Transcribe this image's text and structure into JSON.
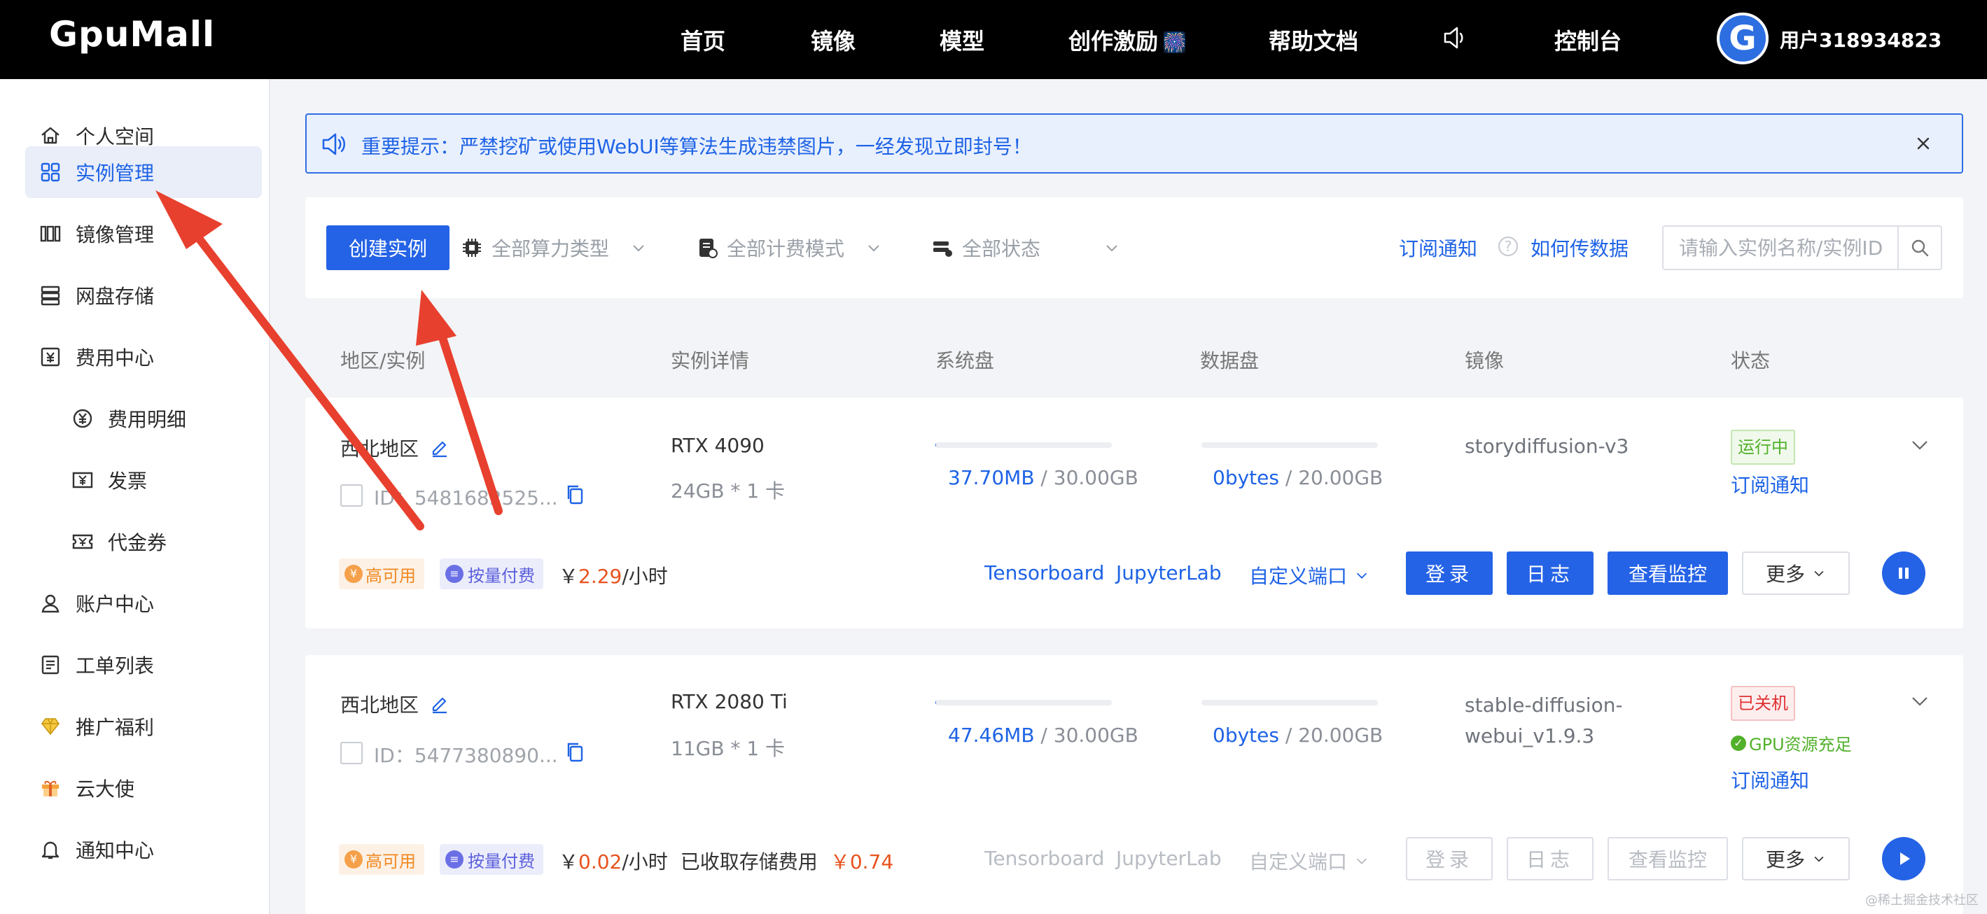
{
  "app": {
    "logo": "GpuMall",
    "username": "用户318934823",
    "avatar_letter": "G"
  },
  "nav": {
    "home": "首页",
    "images": "镜像",
    "models": "模型",
    "incentive": "创作激励",
    "incentive_emoji": "🎆",
    "docs": "帮助文档",
    "console": "控制台"
  },
  "sidebar": {
    "items": [
      {
        "label": "个人空间",
        "icon": "home-icon"
      },
      {
        "label": "实例管理",
        "icon": "grid-icon",
        "active": true
      },
      {
        "label": "镜像管理",
        "icon": "image-stack-icon"
      },
      {
        "label": "网盘存储",
        "icon": "storage-icon"
      },
      {
        "label": "费用中心",
        "icon": "yen-ledger-icon"
      },
      {
        "label": "费用明细",
        "icon": "yen-circle-icon"
      },
      {
        "label": "发票",
        "icon": "invoice-icon"
      },
      {
        "label": "代金券",
        "icon": "coupon-icon"
      },
      {
        "label": "账户中心",
        "icon": "user-icon"
      },
      {
        "label": "工单列表",
        "icon": "ticket-list-icon"
      },
      {
        "label": "推广福利",
        "icon": "diamond-icon"
      },
      {
        "label": "云大使",
        "icon": "gift-icon"
      },
      {
        "label": "通知中心",
        "icon": "bell-icon"
      }
    ]
  },
  "notice": {
    "text": "重要提示：严禁挖矿或使用WebUI等算法生成违禁图片，一经发现立即封号！"
  },
  "toolbar": {
    "create": "创建实例",
    "filter_compute": "全部算力类型",
    "filter_billing": "全部计费模式",
    "filter_status": "全部状态",
    "subscribe": "订阅通知",
    "how_transfer": "如何传数据",
    "search_placeholder": "请输入实例名称/实例ID"
  },
  "table_headers": {
    "region": "地区/实例",
    "detail": "实例详情",
    "sys_disk": "系统盘",
    "data_disk": "数据盘",
    "image": "镜像",
    "status": "状态"
  },
  "instances": [
    {
      "region": "西北地区",
      "id": "ID：5481682525...",
      "gpu": "RTX 4090",
      "spec": "24GB * 1 卡",
      "sys_used": "37.70MB",
      "sys_total": " / 30.00GB",
      "sys_ratio": 0.0013,
      "data_used": "0bytes",
      "data_total": " / 20.00GB",
      "data_ratio": 0,
      "image": "storydiffusion-v3",
      "status": "运行中",
      "subscribe": "订阅通知",
      "tag_ha": "高可用",
      "tag_pay": "按量付费",
      "price_prefix": "￥",
      "price": "2.29",
      "price_unit": "/小时",
      "tensorboard": "Tensorboard",
      "jupyterlab": "JupyterLab",
      "custom_port": "自定义端口",
      "login": "登录",
      "log": "日志",
      "monitor": "查看监控",
      "more": "更多"
    },
    {
      "region": "西北地区",
      "id": "ID：5477380890...",
      "gpu": "RTX 2080 Ti",
      "spec": "11GB * 1 卡",
      "sys_used": "47.46MB",
      "sys_total": " / 30.00GB",
      "sys_ratio": 0.0015,
      "data_used": "0bytes",
      "data_total": " / 20.00GB",
      "data_ratio": 0,
      "image": "stable-diffusion-webui_v1.9.3",
      "status": "已关机",
      "gpu_ok": "GPU资源充足",
      "subscribe": "订阅通知",
      "tag_ha": "高可用",
      "tag_pay": "按量付费",
      "price_prefix": "￥",
      "price": "0.02",
      "price_unit": "/小时",
      "storage_fee_label": "已收取存储费用",
      "storage_fee": "￥0.74",
      "tensorboard": "Tensorboard",
      "jupyterlab": "JupyterLab",
      "custom_port": "自定义端口",
      "login": "登录",
      "log": "日志",
      "monitor": "查看监控",
      "more": "更多"
    }
  ],
  "watermark": "@稀土掘金技术社区",
  "colors": {
    "primary": "#2563e6",
    "annotation_arrow": "#e8402e",
    "running": "#52b12b",
    "stopped": "#e03030",
    "price": "#e8531f"
  }
}
